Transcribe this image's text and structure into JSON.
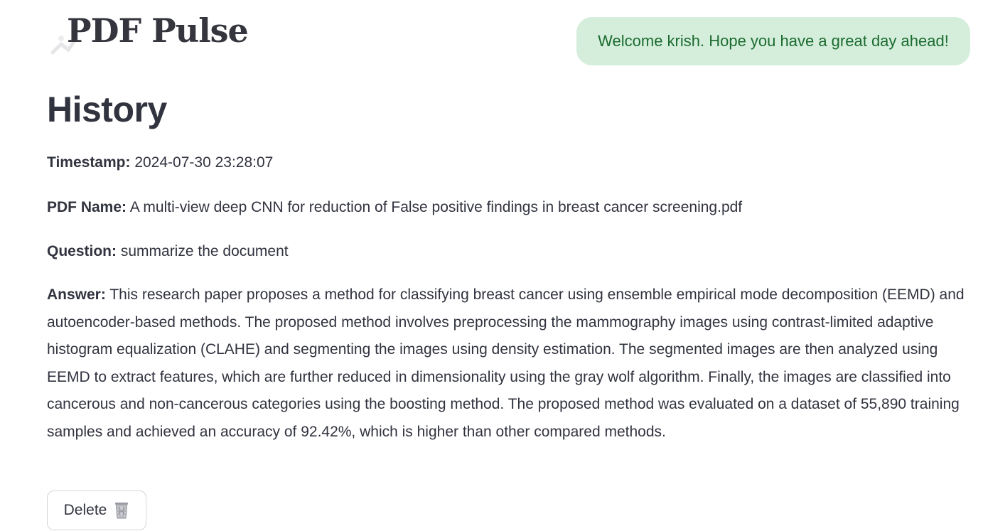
{
  "header": {
    "logo_text": "PDF Pulse",
    "welcome_message": "Welcome krish. Hope you have a great day ahead!"
  },
  "main": {
    "title": "History",
    "entry": {
      "timestamp_label": "Timestamp:",
      "timestamp_value": "2024-07-30 23:28:07",
      "pdf_label": "PDF Name:",
      "pdf_value": "A multi-view deep CNN for reduction of False positive findings in breast cancer screening.pdf",
      "question_label": "Question:",
      "question_value": "summarize the document",
      "answer_label": "Answer:",
      "answer_value": "This research paper proposes a method for classifying breast cancer using ensemble empirical mode decomposition (EEMD) and autoencoder-based methods. The proposed method involves preprocessing the mammography images using contrast-limited adaptive histogram equalization (CLAHE) and segmenting the images using density estimation. The segmented images are then analyzed using EEMD to extract features, which are further reduced in dimensionality using the gray wolf algorithm. Finally, the images are classified into cancerous and non-cancerous categories using the boosting method. The proposed method was evaluated on a dataset of 55,890 training samples and achieved an accuracy of 92.42%, which is higher than other compared methods.",
      "delete_label": "Delete",
      "delete_icon": "wastebasket-icon"
    }
  },
  "colors": {
    "welcome_bg": "#d4eedb",
    "welcome_text": "#1c6b30",
    "text": "#31333f"
  }
}
